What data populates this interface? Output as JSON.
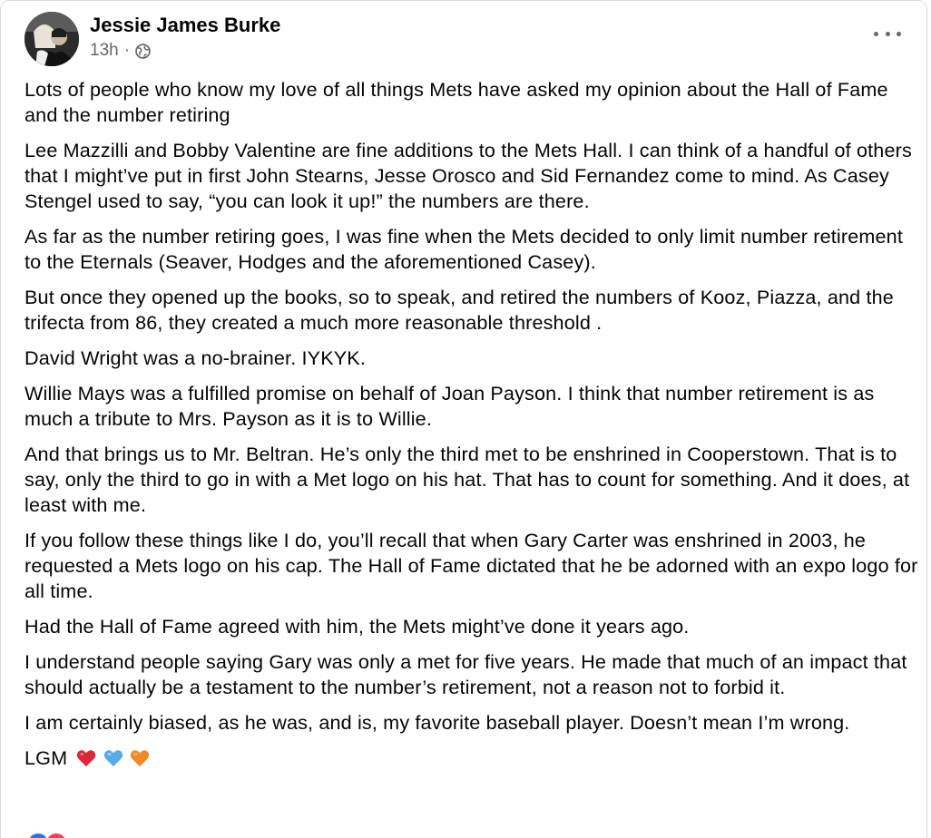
{
  "post": {
    "author": "Jessie James Burke",
    "time": "13h",
    "separator": "·",
    "privacy_icon": "globe-icon",
    "more_icon": "more-options-icon",
    "paragraphs": [
      "Lots of people who know my love of all things Mets have asked my opinion about the Hall of Fame and the number retiring",
      "Lee Mazzilli and Bobby Valentine are fine additions to the Mets Hall. I can think of a handful of others that I might’ve put in first John Stearns, Jesse Orosco and Sid Fernandez come to mind.  As Casey Stengel used to say, “you can look it up!” the numbers are there.",
      "As far as the number retiring goes, I was fine when the Mets decided to only limit number retirement to the Eternals (Seaver, Hodges and the aforementioned Casey).",
      "But once they opened up the books, so to speak, and retired the numbers of Kooz, Piazza, and the trifecta from 86, they created a much more   reasonable threshold .",
      "David Wright was a no-brainer. IYKYK.",
      "Willie Mays was a fulfilled promise on behalf of Joan Payson. I think that number retirement is as much a tribute to Mrs. Payson as it is to Willie.",
      "And that brings us to Mr. Beltran. He’s only the third met to be enshrined in Cooperstown. That is to say, only the third to go in with a Met logo on his hat.   That has to count for something. And it does, at least with me.",
      "If you follow these things like I do, you’ll recall that when Gary Carter was enshrined in 2003, he requested a Mets logo on his cap. The Hall of Fame dictated that he be adorned with an expo logo for all time.",
      "Had the Hall of Fame agreed with him, the Mets might’ve done it years ago.",
      "I understand people saying Gary was only a met for five years. He made that much of an impact that should actually be a testament to the number’s retirement, not a reason not to forbid it.",
      "I am certainly biased, as he was, and is, my favorite baseball player. Doesn’t mean I’m wrong."
    ],
    "signoff": "LGM",
    "hearts": [
      {
        "name": "red-heart-icon",
        "color": "#e0243a"
      },
      {
        "name": "blue-heart-icon",
        "color": "#5aa9ec"
      },
      {
        "name": "orange-heart-icon",
        "color": "#f08a24"
      }
    ],
    "reactions": [
      {
        "name": "like-reaction-icon",
        "color": "#1877f2"
      },
      {
        "name": "love-reaction-icon",
        "color": "#f33e58"
      }
    ]
  }
}
